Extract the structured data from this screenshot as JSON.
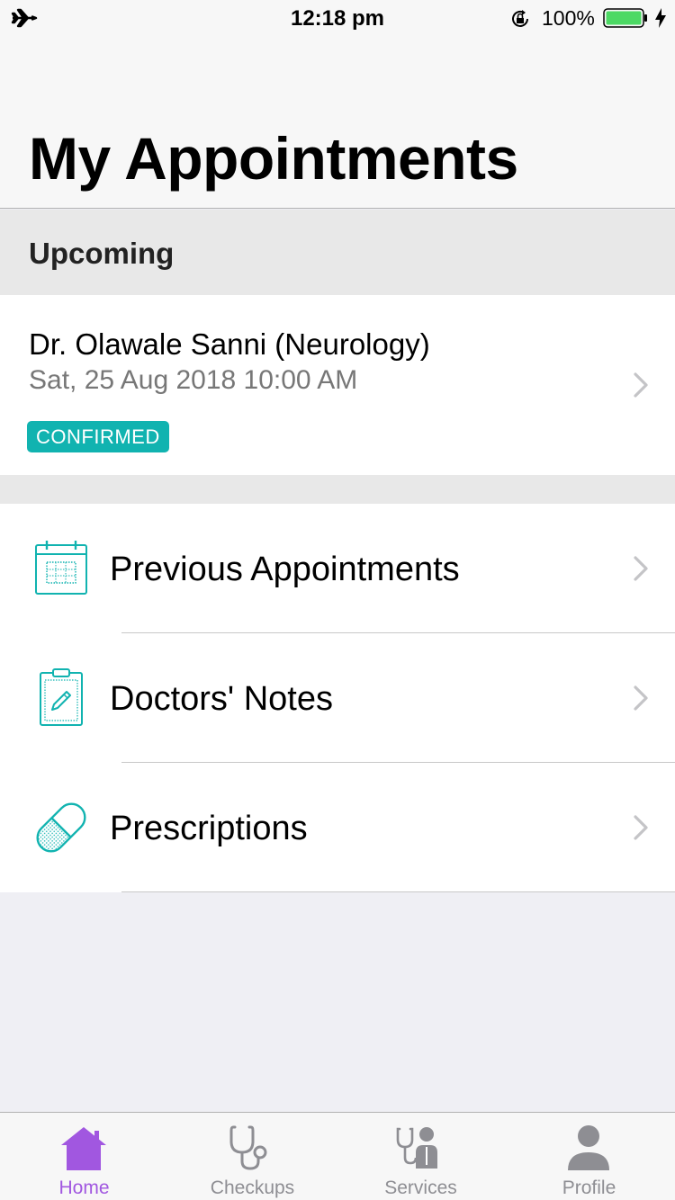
{
  "status_bar": {
    "time": "12:18 pm",
    "battery_percent": "100%",
    "battery_color": "#4cd964",
    "icons": [
      "airplane-icon",
      "orientation-lock-icon",
      "battery-icon",
      "charging-bolt-icon"
    ]
  },
  "header": {
    "title": "My Appointments"
  },
  "upcoming": {
    "section_label": "Upcoming",
    "appointment": {
      "doctor": "Dr. Olawale Sanni (Neurology)",
      "datetime": "Sat, 25 Aug 2018 10:00 AM",
      "status": "CONFIRMED",
      "status_color": "#11b3b0"
    }
  },
  "menu": {
    "items": [
      {
        "label": "Previous Appointments",
        "icon": "calendar-icon"
      },
      {
        "label": "Doctors' Notes",
        "icon": "clipboard-icon"
      },
      {
        "label": "Prescriptions",
        "icon": "pill-icon"
      }
    ],
    "icon_color": "#11b3b0"
  },
  "tab_bar": {
    "active_color": "#a157e0",
    "inactive_color": "#8e8e93",
    "tabs": [
      {
        "label": "Home",
        "icon": "home-icon",
        "active": true
      },
      {
        "label": "Checkups",
        "icon": "stethoscope-icon",
        "active": false
      },
      {
        "label": "Services",
        "icon": "doctor-icon",
        "active": false
      },
      {
        "label": "Profile",
        "icon": "profile-icon",
        "active": false
      }
    ]
  }
}
